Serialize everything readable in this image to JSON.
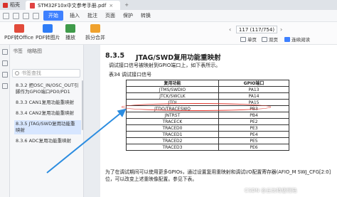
{
  "titlebar": {
    "home_label": "稻壳",
    "doc_tab": "STM32F10x中文参考手册.pdf",
    "close_glyph": "×",
    "plus_glyph": "+"
  },
  "menubar": {
    "start": "开始",
    "items": [
      "插入",
      "批注",
      "页面",
      "保护",
      "转换"
    ]
  },
  "toolbar": {
    "tools": [
      {
        "label": "PDF转Office",
        "icon": "pdf-to-office-icon",
        "color": "#e24b3b"
      },
      {
        "label": "PDF转图片",
        "icon": "pdf-to-image-icon",
        "color": "#2f7df6"
      },
      {
        "label": "播放",
        "icon": "play-icon",
        "color": "#3f9b4a"
      },
      {
        "label": "拆分合并",
        "icon": "split-merge-icon",
        "color": "#f0a22e"
      }
    ],
    "page_indicator": "117 (117/754)",
    "prev_glyph": "‹",
    "next_glyph": "›",
    "view_modes": [
      "单页",
      "双页",
      "连续阅读"
    ]
  },
  "sidebar": {
    "tabs": [
      "书签",
      "缩略图"
    ],
    "search_placeholder": "书签查找",
    "items": [
      "8.3.2 把OSC_IN/OSC_OUT引脚作为GPIO端口PD0/PD1",
      "8.3.3 CAN1复用功能重映射",
      "8.3.4 CAN2复用功能重映射",
      "8.3.5 JTAG/SWD复用功能重映射",
      "8.3.6 ADC复用功能重映射"
    ],
    "active_index": 3
  },
  "document": {
    "section_number": "8.3.5",
    "section_title": "JTAG/SWD复用功能重映射",
    "paragraph1": "调试接口信号被映射到GPIO端口上，如下表所示。",
    "table_caption": "表34    调试接口信号",
    "table": {
      "headers": [
        "复用功能",
        "GPIO端口"
      ],
      "rows": [
        [
          "JTMS/SWDIO",
          "PA13"
        ],
        [
          "JTCK/SWCLK",
          "PA14"
        ],
        [
          "JTDI",
          "PA15"
        ],
        [
          "JTDO/TRACESWO",
          "PB3"
        ],
        [
          "JNTRST",
          "PB4"
        ],
        [
          "TRACECK",
          "PE2"
        ],
        [
          "TRACED0",
          "PE3"
        ],
        [
          "TRACED1",
          "PE4"
        ],
        [
          "TRACED2",
          "PE5"
        ],
        [
          "TRACED3",
          "PE6"
        ]
      ]
    },
    "paragraph2": "为了在调试期间可以使用更多GPIOs，通过设置复用重映射和调试I/O配置寄存器(AFIO_M SWJ_CFG[2:0]位，可以改变上述重映像配置。参见下表。"
  },
  "watermark": "CSDN @丘比特惩罚陆",
  "colors": {
    "accent": "#3e80ff",
    "highlight_ring": "#e0342b",
    "arrow": "#2b8ce0"
  }
}
